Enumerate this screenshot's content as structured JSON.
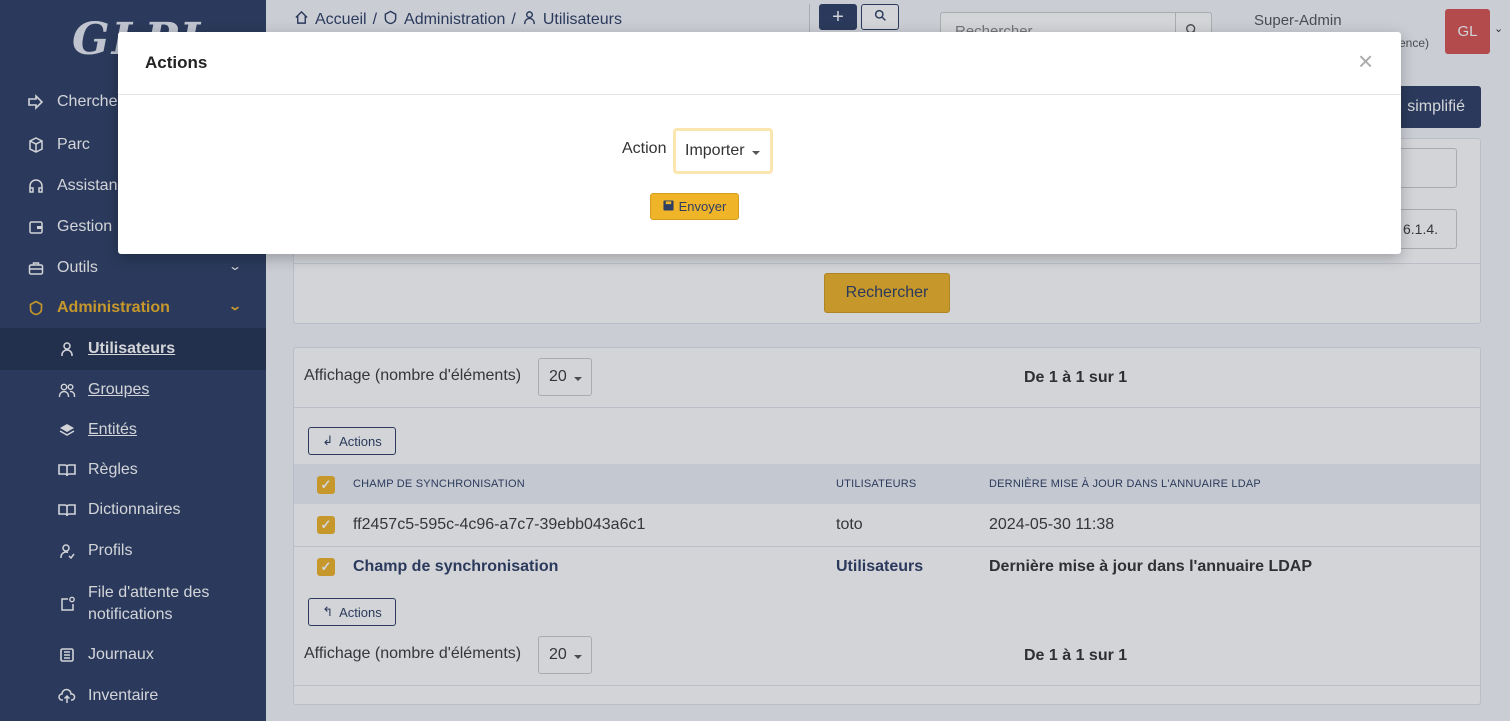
{
  "app": {
    "logo": "GLPI"
  },
  "sidebar": {
    "items": [
      {
        "label": "Chercher",
        "icon": "arrow-right-icon"
      },
      {
        "label": "Parc",
        "icon": "package-icon"
      },
      {
        "label": "Assistance",
        "icon": "headset-icon"
      },
      {
        "label": "Gestion",
        "icon": "wallet-icon"
      },
      {
        "label": "Outils",
        "icon": "briefcase-icon"
      },
      {
        "label": "Administration",
        "icon": "shield-icon"
      }
    ],
    "subitems": [
      {
        "label": "Utilisateurs",
        "icon": "user-icon"
      },
      {
        "label": "Groupes",
        "icon": "users-icon"
      },
      {
        "label": "Entités",
        "icon": "layers-icon"
      },
      {
        "label": "Règles",
        "icon": "book-icon"
      },
      {
        "label": "Dictionnaires",
        "icon": "book-icon"
      },
      {
        "label": "Profils",
        "icon": "user-check-icon"
      },
      {
        "label": "File d'attente des notifications",
        "icon": "notification-icon"
      },
      {
        "label": "Journaux",
        "icon": "news-icon"
      },
      {
        "label": "Inventaire",
        "icon": "cloud-upload-icon"
      }
    ]
  },
  "header": {
    "breadcrumb": [
      "Accueil",
      "Administration",
      "Utilisateurs"
    ],
    "search_placeholder": "Rechercher",
    "user_role": "Super-Admin",
    "user_entity": "ence)",
    "avatar": "GL"
  },
  "toolbar": {
    "simplified_label": "simplifié"
  },
  "search_form": {
    "partial_value": "6.1.4.",
    "submit_label": "Rechercher"
  },
  "list": {
    "display_label": "Affichage (nombre d'éléments)",
    "page_size": "20",
    "pagination": "De 1 à 1 sur 1",
    "actions_label": "Actions",
    "columns": [
      "Champ de synchronisation",
      "Utilisateurs",
      "Dernière mise à jour dans l'annuaire LDAP"
    ],
    "rows": [
      {
        "sync": "ff2457c5-595c-4c96-a7c7-39ebb043a6c1",
        "user": "toto",
        "updated": "2024-05-30 11:38"
      }
    ]
  },
  "modal": {
    "title": "Actions",
    "close": "×",
    "action_label": "Action",
    "action_value": "Importer",
    "submit_label": "Envoyer"
  },
  "colors": {
    "sidebar": "#2f3f64",
    "accent": "#f0b429",
    "avatar": "#d9534f"
  }
}
